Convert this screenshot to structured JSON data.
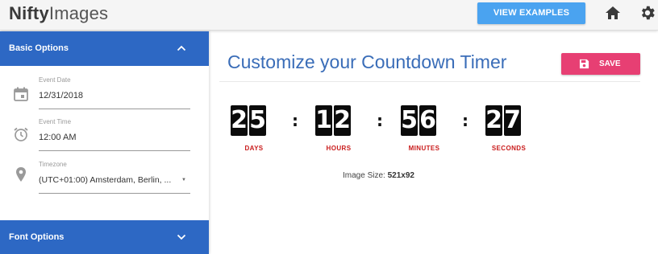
{
  "app": {
    "logo_bold": "Nifty",
    "logo_light": "Images"
  },
  "header": {
    "view_examples_label": "VIEW EXAMPLES",
    "home_icon": "home-icon",
    "settings_icon": "gear-icon"
  },
  "sidebar": {
    "basic_options_label": "Basic Options",
    "font_options_label": "Font Options",
    "fields": [
      {
        "icon": "calendar-icon",
        "label": "Event Date",
        "value": "12/31/2018"
      },
      {
        "icon": "alarm-clock-icon",
        "label": "Event Time",
        "value": "12:00 AM"
      },
      {
        "icon": "location-pin-icon",
        "label": "Timezone",
        "value": "(UTC+01:00) Amsterdam, Berlin, ..."
      }
    ]
  },
  "main": {
    "title": "Customize your Countdown Timer",
    "save_label": "SAVE",
    "timer": {
      "days": "25",
      "hours": "12",
      "minutes": "56",
      "seconds": "27",
      "days_label": "DAYS",
      "hours_label": "HOURS",
      "minutes_label": "MINUTES",
      "seconds_label": "SECONDS"
    },
    "image_size_label": "Image Size:",
    "image_size_value": "521x92"
  },
  "colors": {
    "accent_blue": "#2d68c4",
    "button_blue": "#4aa3f0",
    "save_pink": "#e73f73",
    "title_blue": "#3a6db8",
    "unit_red": "#c91b1b"
  }
}
